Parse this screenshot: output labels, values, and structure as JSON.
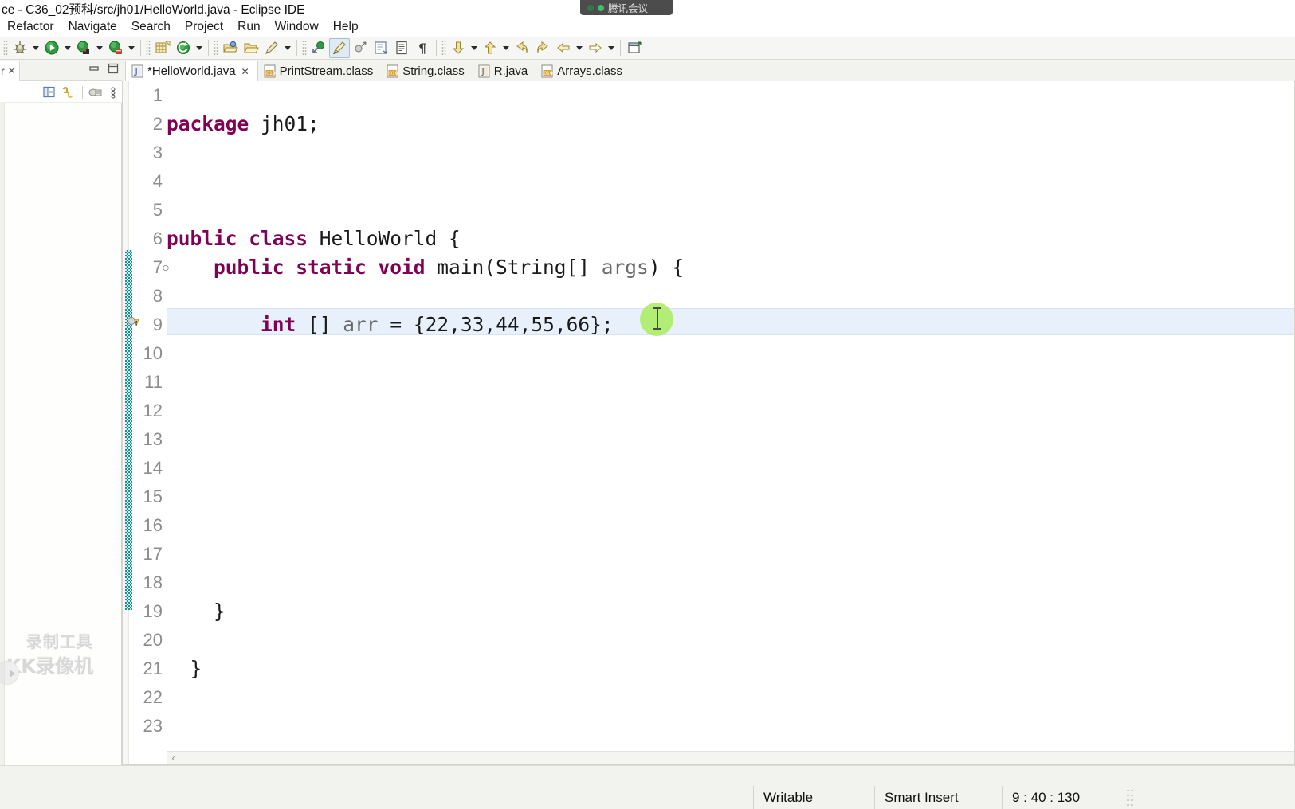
{
  "window": {
    "title": "ce - C36_02预科/src/jh01/HelloWorld.java - Eclipse IDE"
  },
  "menubar": {
    "items": [
      {
        "label": "Refactor",
        "name": "menu-refactor"
      },
      {
        "label": "Navigate",
        "name": "menu-navigate"
      },
      {
        "label": "Search",
        "name": "menu-search"
      },
      {
        "label": "Project",
        "name": "menu-project"
      },
      {
        "label": "Run",
        "name": "menu-run"
      },
      {
        "label": "Window",
        "name": "menu-window"
      },
      {
        "label": "Help",
        "name": "menu-help"
      }
    ]
  },
  "toolbar": {
    "buttons": [
      {
        "name": "debug-button",
        "icon": "debug-bug-icon"
      },
      {
        "name": "run-button",
        "icon": "run-play-icon"
      },
      {
        "name": "coverage-button",
        "icon": "coverage-icon"
      },
      {
        "name": "profile-button",
        "icon": "profile-icon"
      },
      {
        "name": "new-java-package-button",
        "icon": "new-package-icon"
      },
      {
        "name": "external-tools-button",
        "icon": "external-tools-icon"
      },
      {
        "name": "open-type-button",
        "icon": "open-type-icon"
      },
      {
        "name": "open-task-button",
        "icon": "open-task-icon"
      },
      {
        "name": "search-button",
        "icon": "search-pencil-icon"
      },
      {
        "name": "toggle-mark-occurrences-button",
        "icon": "mark-occurrences-icon"
      },
      {
        "name": "open-perspective-button",
        "icon": "perspective-icon"
      },
      {
        "name": "skip-breakpoints-button",
        "icon": "skip-breakpoints-icon"
      },
      {
        "name": "new-java-class-button",
        "icon": "new-class-icon"
      },
      {
        "name": "show-whitespace-button",
        "icon": "whitespace-icon"
      },
      {
        "name": "show-pilcrow-button",
        "icon": "pilcrow-icon"
      },
      {
        "name": "next-annotation-button",
        "icon": "arrow-down-icon"
      },
      {
        "name": "previous-annotation-button",
        "icon": "arrow-up-icon"
      },
      {
        "name": "back-button",
        "icon": "arrow-left-yellow-icon"
      },
      {
        "name": "forward-button",
        "icon": "arrow-right-yellow-icon"
      },
      {
        "name": "previous-edit-button",
        "icon": "arrow-left-outline-icon"
      },
      {
        "name": "next-edit-button",
        "icon": "arrow-right-outline-icon"
      },
      {
        "name": "open-perspective-right-button",
        "icon": "perspective-window-icon"
      }
    ]
  },
  "left_pane": {
    "tab_label": "r",
    "tab_close": "✕",
    "tools": [
      {
        "name": "collapse-all-icon",
        "label": "collapse-all"
      },
      {
        "name": "link-with-editor-icon",
        "label": "link-with-editor"
      },
      {
        "name": "focus-on-active-task-icon",
        "label": "focus-active-task"
      },
      {
        "name": "view-menu-icon",
        "label": "view-menu"
      }
    ],
    "minimize_label": "▬",
    "maximize_label": "▢"
  },
  "editor": {
    "tabs": [
      {
        "label": "*HelloWorld.java",
        "icon": "java-file-icon",
        "selected": true,
        "close": "✕"
      },
      {
        "label": "PrintStream.class",
        "icon": "class-file-icon",
        "selected": false,
        "close": ""
      },
      {
        "label": "String.class",
        "icon": "class-file-icon",
        "selected": false,
        "close": ""
      },
      {
        "label": "R.java",
        "icon": "java-file-icon",
        "selected": false,
        "close": ""
      },
      {
        "label": "Arrays.class",
        "icon": "class-file-icon",
        "selected": false,
        "close": ""
      }
    ],
    "line_numbers": [
      "1",
      "2",
      "3",
      "4",
      "5",
      "6",
      "7",
      "8",
      "9",
      "10",
      "11",
      "12",
      "13",
      "14",
      "15",
      "16",
      "17",
      "18",
      "19",
      "20",
      "21",
      "22",
      "23"
    ],
    "highlighted_line": 9,
    "lines": [
      {
        "n": 1,
        "text": ""
      },
      {
        "n": 2,
        "text": "package jh01;",
        "html": "<span class=\"kw\">package</span> jh01;"
      },
      {
        "n": 3,
        "text": ""
      },
      {
        "n": 4,
        "text": ""
      },
      {
        "n": 5,
        "text": ""
      },
      {
        "n": 6,
        "text": "public class HelloWorld {",
        "html": "<span class=\"kw\">public class</span> HelloWorld {"
      },
      {
        "n": 7,
        "text": "    public static void main(String[] args) {",
        "html": "    <span class=\"kw\">public static void</span> main(String[] <span class=\"param\">args</span>) {"
      },
      {
        "n": 8,
        "text": ""
      },
      {
        "n": 9,
        "text": "        int [] arr = {22,33,44,55,66};",
        "html": "        <span class=\"kw\">int</span> [] <span class=\"fieldname\">arr</span> = {22,33,44,55,66};"
      },
      {
        "n": 10,
        "text": ""
      },
      {
        "n": 11,
        "text": ""
      },
      {
        "n": 12,
        "text": ""
      },
      {
        "n": 13,
        "text": ""
      },
      {
        "n": 14,
        "text": ""
      },
      {
        "n": 15,
        "text": ""
      },
      {
        "n": 16,
        "text": ""
      },
      {
        "n": 17,
        "text": ""
      },
      {
        "n": 18,
        "text": ""
      },
      {
        "n": 19,
        "text": "    }",
        "html": "    }"
      },
      {
        "n": 20,
        "text": ""
      },
      {
        "n": 21,
        "text": "  }",
        "html": "  }"
      },
      {
        "n": 22,
        "text": ""
      },
      {
        "n": 23,
        "text": ""
      }
    ],
    "scroll_left_arrow": "‹"
  },
  "statusbar": {
    "writable": "Writable",
    "insert_mode": "Smart Insert",
    "position": "9 : 40 : 130"
  },
  "overlays": {
    "tencent_meeting": "腾讯会议",
    "watermark_line1": "录制工具",
    "watermark_line2": "KK录像机"
  },
  "colors": {
    "keyword": "#7F0055",
    "highlight_line": "#e8f1fb",
    "change_bar": "#1e8f90",
    "click_dot": "#a8ec5e",
    "toolbar_bg": "#f6f6f4",
    "status_bg": "#f2f2ef"
  }
}
